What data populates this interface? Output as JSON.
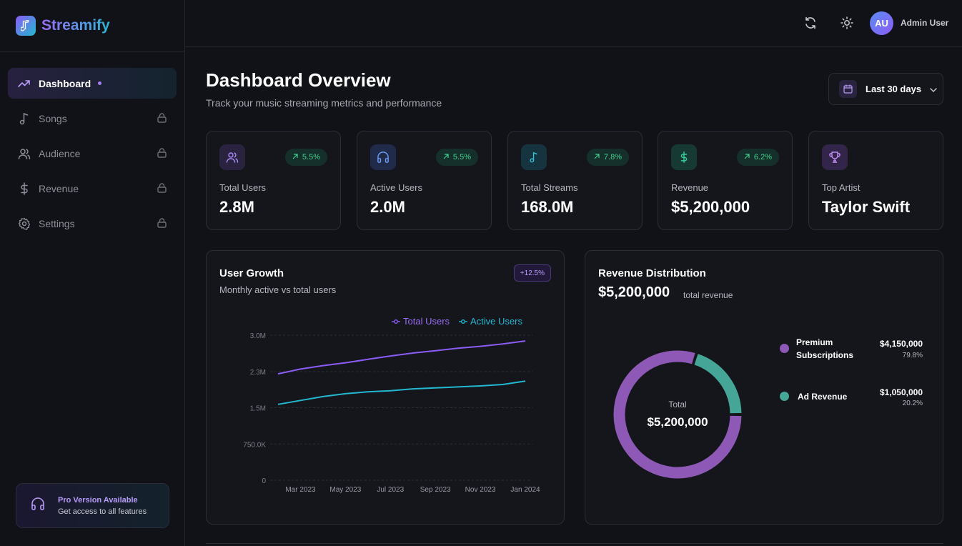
{
  "brand": {
    "name": "Streamify"
  },
  "sidebar": {
    "items": [
      {
        "label": "Dashboard",
        "icon": "trending-up-icon",
        "active": true
      },
      {
        "label": "Songs",
        "icon": "music-note-icon",
        "locked": true
      },
      {
        "label": "Audience",
        "icon": "users-icon",
        "locked": true
      },
      {
        "label": "Revenue",
        "icon": "dollar-icon",
        "locked": true
      },
      {
        "label": "Settings",
        "icon": "gear-icon",
        "locked": true
      }
    ],
    "pro": {
      "title": "Pro Version Available",
      "subtitle": "Get access to all features"
    }
  },
  "topbar": {
    "avatar_initials": "AU",
    "user_name": "Admin User"
  },
  "header": {
    "title": "Dashboard Overview",
    "subtitle": "Track your music streaming metrics and performance",
    "date_range": "Last 30 days"
  },
  "stats": [
    {
      "label": "Total Users",
      "value": "2.8M",
      "change": "5.5%",
      "icon": "users-icon",
      "color": "#8b5cf6"
    },
    {
      "label": "Active Users",
      "value": "2.0M",
      "change": "5.5%",
      "icon": "headphones-icon",
      "color": "#5b8cf5"
    },
    {
      "label": "Total Streams",
      "value": "168.0M",
      "change": "7.8%",
      "icon": "music-note-icon",
      "color": "#22b8cf"
    },
    {
      "label": "Revenue",
      "value": "$5,200,000",
      "change": "6.2%",
      "icon": "dollar-icon",
      "color": "#2fbf8f"
    },
    {
      "label": "Top Artist",
      "value": "Taylor Swift",
      "icon": "trophy-icon",
      "color": "#b07cf5"
    }
  ],
  "growth": {
    "title": "User Growth",
    "subtitle": "Monthly active vs total users",
    "badge": "+12.5%"
  },
  "chart_data": [
    {
      "type": "line",
      "x": [
        "Feb 2023",
        "Mar 2023",
        "Apr 2023",
        "May 2023",
        "Jun 2023",
        "Jul 2023",
        "Aug 2023",
        "Sep 2023",
        "Oct 2023",
        "Nov 2023",
        "Dec 2023",
        "Jan 2024"
      ],
      "x_tick_labels": [
        "Mar 2023",
        "May 2023",
        "Jul 2023",
        "Sep 2023",
        "Nov 2023",
        "Jan 2024"
      ],
      "y_tick_labels": [
        "0",
        "750.0K",
        "1.5M",
        "2.3M",
        "3.0M"
      ],
      "y_ticks": [
        0,
        750000,
        1500000,
        2250000,
        3000000
      ],
      "ylim": [
        0,
        3000000
      ],
      "series": [
        {
          "name": "Total Users",
          "color": "#8b5cf6",
          "values": [
            2200000,
            2300000,
            2370000,
            2430000,
            2500000,
            2570000,
            2630000,
            2680000,
            2730000,
            2770000,
            2820000,
            2880000
          ]
        },
        {
          "name": "Active Users",
          "color": "#22b8cf",
          "values": [
            1570000,
            1650000,
            1730000,
            1790000,
            1830000,
            1850000,
            1890000,
            1910000,
            1930000,
            1950000,
            1980000,
            2050000
          ]
        }
      ],
      "grid": true,
      "legend": "top-right"
    },
    {
      "type": "pie",
      "title": "Revenue Distribution",
      "total": "$5,200,000",
      "total_label": "total revenue",
      "center_label": "Total",
      "slices": [
        {
          "name": "Premium Subscriptions",
          "amount": "$4,150,000",
          "pct": "79.8%",
          "value": 79.8,
          "color": "#8e59b6"
        },
        {
          "name": "Ad Revenue",
          "amount": "$1,050,000",
          "pct": "20.2%",
          "value": 20.2,
          "color": "#45a596"
        }
      ]
    }
  ]
}
